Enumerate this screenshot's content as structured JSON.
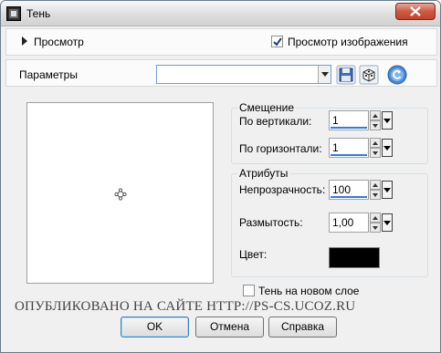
{
  "window": {
    "title": "Тень",
    "close_icon": "close-icon"
  },
  "preview": {
    "label": "Просмотр",
    "checkbox_label": "Просмотр изображения",
    "checked": true
  },
  "params": {
    "label": "Параметры",
    "preset_value": "",
    "icons": [
      "save-preset-icon",
      "random-dice-icon",
      "reset-icon"
    ]
  },
  "offset": {
    "title": "Смещение",
    "vertical_label": "По вертикали:",
    "vertical_value": "1",
    "horizontal_label": "По горизонтали:",
    "horizontal_value": "1"
  },
  "attributes": {
    "title": "Атрибуты",
    "opacity_label": "Непрозрачность:",
    "opacity_value": "100",
    "blur_label": "Размытость:",
    "blur_value": "1,00",
    "color_label": "Цвет:",
    "color_value": "#000000"
  },
  "new_layer": {
    "label": "Тень на новом слое",
    "checked": false
  },
  "watermark": "ОПУБЛИКОВАНО   НА САЙТЕ   HTTP://PS-CS.UCOZ.RU",
  "buttons": {
    "ok": "OK",
    "cancel": "Отмена",
    "help": "Справка"
  }
}
